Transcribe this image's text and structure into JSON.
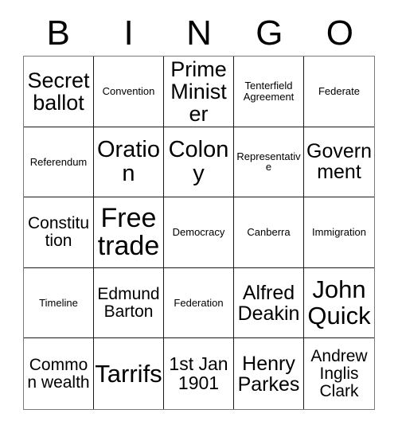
{
  "card": {
    "header_letters": [
      "B",
      "I",
      "N",
      "G",
      "O"
    ],
    "columns": 5,
    "rows": 5,
    "border_color": "#1a1a1a",
    "outer_border_color": "#7a7a7a",
    "background_color": "#ffffff",
    "text_color": "#000000",
    "cells": [
      [
        {
          "text": "Secret ballot",
          "size": "t-mdl"
        },
        {
          "text": "Convention",
          "size": "t-xxs"
        },
        {
          "text": "Prime Minister",
          "size": "t-mdl"
        },
        {
          "text": "Tenterfield Agreement",
          "size": "t-xxs"
        },
        {
          "text": "Federate",
          "size": "t-xxs"
        }
      ],
      [
        {
          "text": "Referendum",
          "size": "t-xxs"
        },
        {
          "text": "Oration",
          "size": "t-lg"
        },
        {
          "text": "Colony",
          "size": "t-lg"
        },
        {
          "text": "Representative",
          "size": "t-xxs"
        },
        {
          "text": "Govern ment",
          "size": "t-md"
        }
      ],
      [
        {
          "text": "Constitu tion",
          "size": "t-xs"
        },
        {
          "text": "Free trade",
          "size": "t-xxl"
        },
        {
          "text": "Democracy",
          "size": "t-xxs"
        },
        {
          "text": "Canberra",
          "size": "t-xxs"
        },
        {
          "text": "Immigration",
          "size": "t-xxs"
        }
      ],
      [
        {
          "text": "Timeline",
          "size": "t-xxs"
        },
        {
          "text": "Edmund Barton",
          "size": "t-xs"
        },
        {
          "text": "Federation",
          "size": "t-xxs"
        },
        {
          "text": "Alfred Deakin",
          "size": "t-md"
        },
        {
          "text": "John Quick",
          "size": "t-xl"
        }
      ],
      [
        {
          "text": "Common wealth",
          "size": "t-xs"
        },
        {
          "text": "Tarrifs",
          "size": "t-xl"
        },
        {
          "text": "1st Jan 1901",
          "size": "t-sm"
        },
        {
          "text": "Henry Parkes",
          "size": "t-md"
        },
        {
          "text": "Andrew Inglis Clark",
          "size": "t-xs"
        }
      ]
    ]
  }
}
